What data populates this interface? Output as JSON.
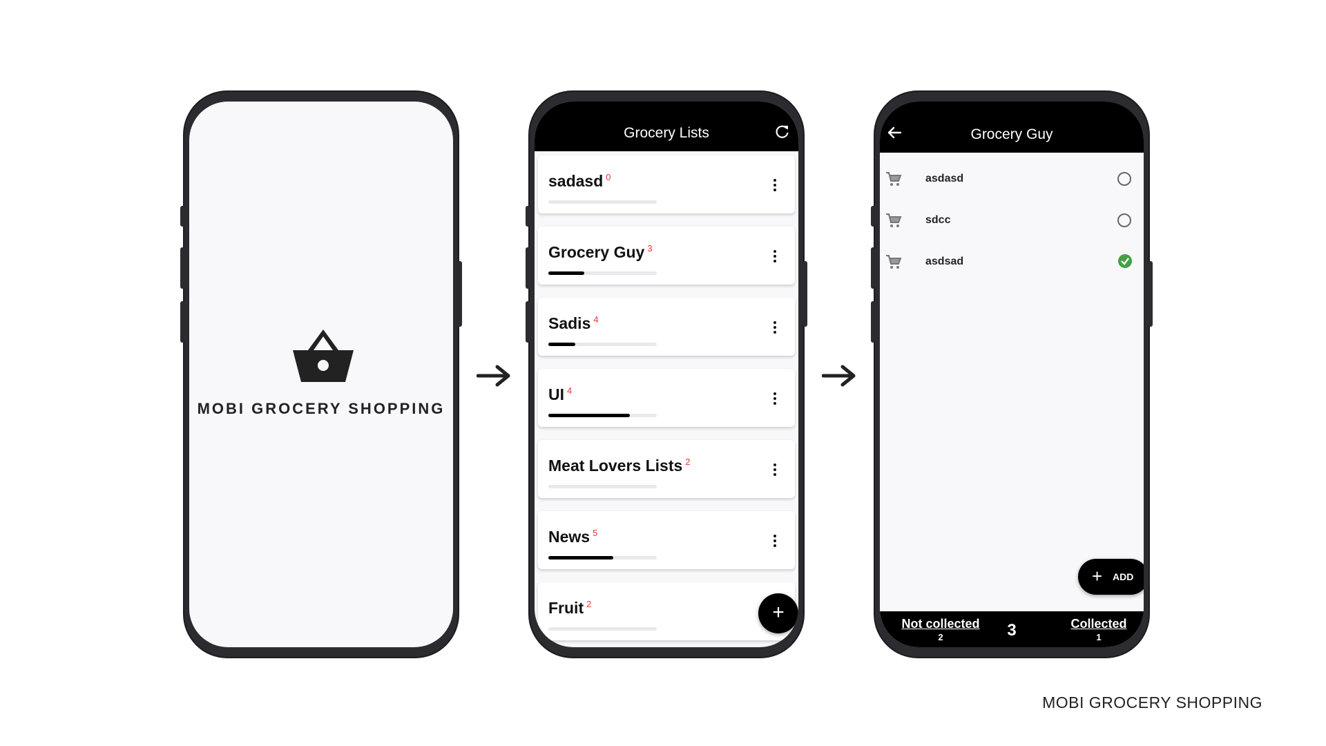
{
  "splash": {
    "logo_icon": "shopping-basket-icon",
    "title": "MOBI GROCERY SHOPPING"
  },
  "lists_screen": {
    "header_title": "Grocery Lists",
    "refresh_icon": "refresh-icon",
    "lists": [
      {
        "name": "sadasd",
        "count": "0",
        "progress": 0
      },
      {
        "name": "Grocery Guy",
        "count": "3",
        "progress": 0.33
      },
      {
        "name": "Sadis",
        "count": "4",
        "progress": 0.25
      },
      {
        "name": "UI",
        "count": "4",
        "progress": 0.75
      },
      {
        "name": "Meat Lovers Lists",
        "count": "2",
        "progress": 0
      },
      {
        "name": "News",
        "count": "5",
        "progress": 0.6
      },
      {
        "name": "Fruit",
        "count": "2",
        "progress": 0
      }
    ],
    "fab_label": "+"
  },
  "detail_screen": {
    "header_title": "Grocery Guy",
    "items": [
      {
        "name": "asdasd",
        "collected": false
      },
      {
        "name": "sdcc",
        "collected": false
      },
      {
        "name": "asdsad",
        "collected": true
      }
    ],
    "add_plus": "+",
    "add_label": "ADD",
    "bottom": {
      "not_collected_label": "Not collected",
      "not_collected_count": "2",
      "total": "3",
      "collected_label": "Collected",
      "collected_count": "1"
    }
  },
  "caption": "MOBI GROCERY SHOPPING",
  "colors": {
    "accent": "#000000",
    "count_red": "#e53935",
    "check_green": "#43a047"
  }
}
